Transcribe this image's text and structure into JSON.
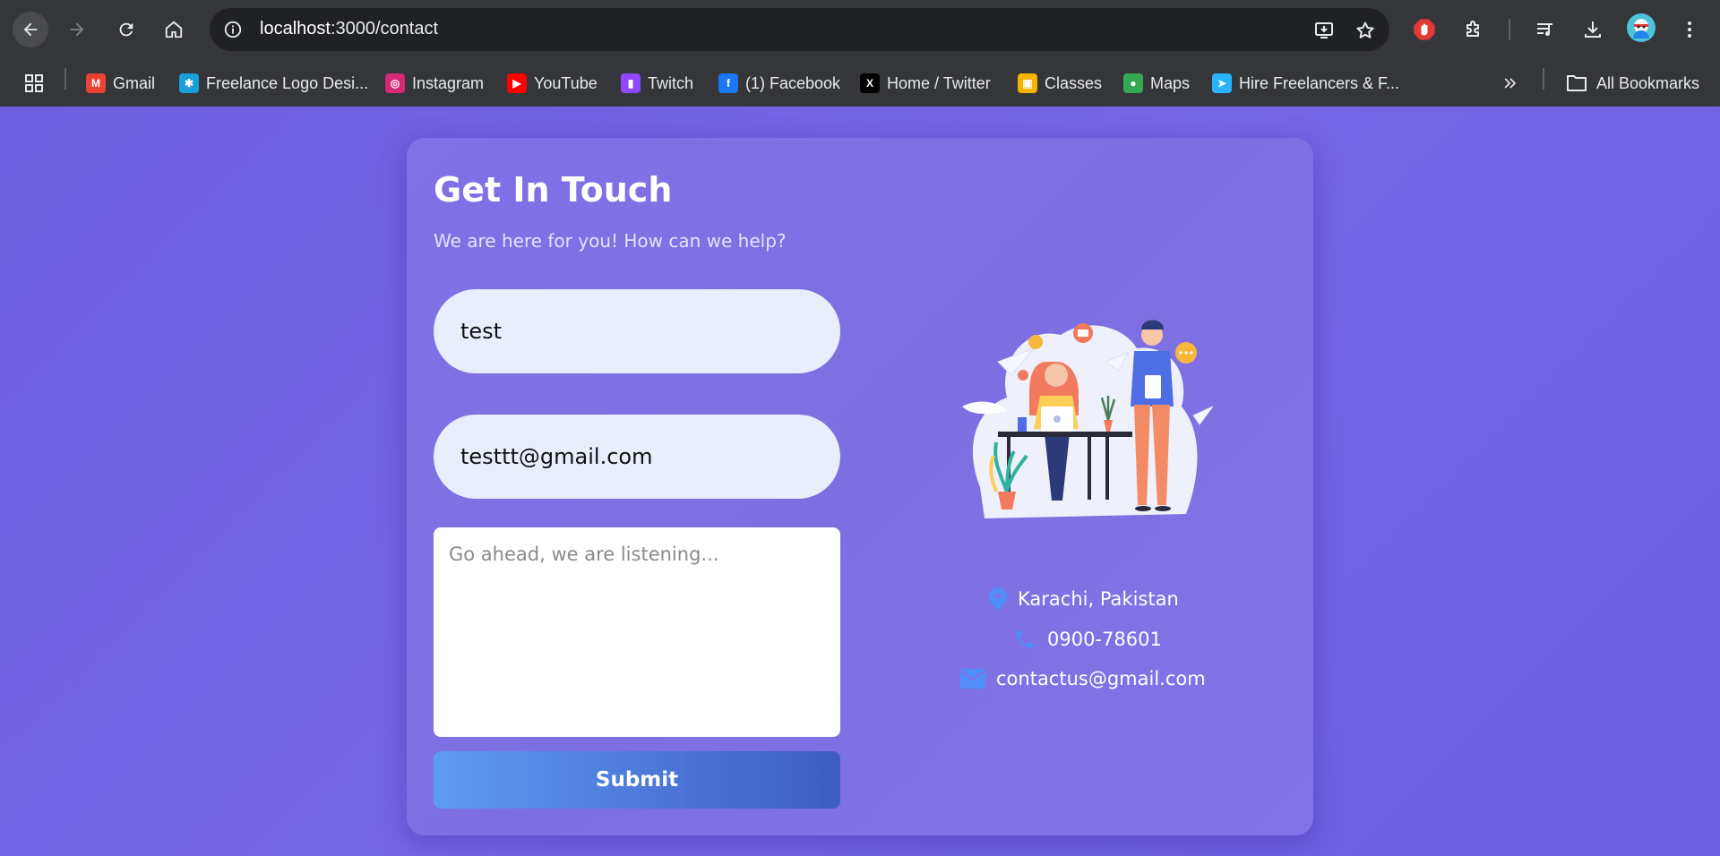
{
  "browser": {
    "url_host": "localhost",
    "url_path": ":3000/contact",
    "bookmarks": [
      {
        "label": "Gmail",
        "icon": "gmail-icon",
        "color": "#ea4335",
        "glyph": "M"
      },
      {
        "label": "Freelance Logo Desi...",
        "icon": "freelance-logo-icon",
        "color": "#1aa0d8",
        "glyph": "✱"
      },
      {
        "label": "Instagram",
        "icon": "instagram-icon",
        "color": "#d62976",
        "glyph": "◎"
      },
      {
        "label": "YouTube",
        "icon": "youtube-icon",
        "color": "#ff0000",
        "glyph": "▶"
      },
      {
        "label": "Twitch",
        "icon": "twitch-icon",
        "color": "#9146ff",
        "glyph": "▮"
      },
      {
        "label": "(1) Facebook",
        "icon": "facebook-icon",
        "color": "#1877f2",
        "glyph": "f"
      },
      {
        "label": "Home / Twitter",
        "icon": "x-icon",
        "color": "#000000",
        "glyph": "X"
      },
      {
        "label": "Classes",
        "icon": "classroom-icon",
        "color": "#f4b400",
        "glyph": "▣"
      },
      {
        "label": "Maps",
        "icon": "maps-icon",
        "color": "#34a853",
        "glyph": "●"
      },
      {
        "label": "Hire Freelancers & F...",
        "icon": "freelancer-icon",
        "color": "#29b2fe",
        "glyph": "➤"
      }
    ],
    "all_bookmarks_label": "All Bookmarks"
  },
  "contact": {
    "title": "Get In Touch",
    "subtitle": "We are here for you! How can we help?",
    "name_value": "test",
    "email_value": "testtt@gmail.com",
    "message_placeholder": "Go ahead, we are listening...",
    "submit_label": "Submit",
    "location": "Karachi, Pakistan",
    "phone": "0900-78601",
    "email": "contactus@gmail.com"
  },
  "colors": {
    "page_bg": "#7163e2",
    "card_bg": "#8070e5",
    "input_bg": "#e8eefc",
    "submit_start": "#5f9bf3",
    "submit_end": "#3f5cc0",
    "contact_icon": "#4f8ef7"
  }
}
